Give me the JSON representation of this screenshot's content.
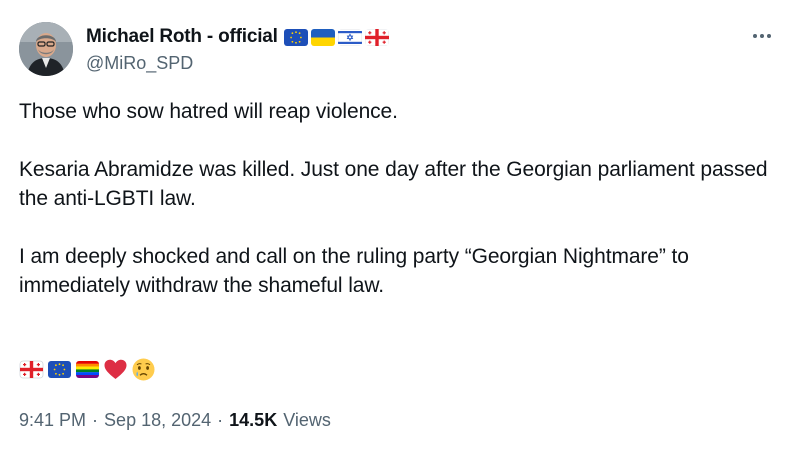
{
  "author": {
    "display_name": "Michael Roth - official",
    "handle": "@MiRo_SPD",
    "flags": [
      "eu-flag-icon",
      "ukraine-flag-icon",
      "israel-flag-icon",
      "georgia-flag-icon"
    ]
  },
  "tweet": {
    "paragraphs": [
      "Those who sow hatred will reap violence.",
      "Kesaria Abramidze  was killed. Just one day after the Georgian parliament passed the anti-LGBTI law.",
      "I am deeply shocked and call on the ruling party “Georgian Nightmare” to immediately withdraw the shameful law."
    ],
    "emojis": [
      "georgia-flag-icon",
      "eu-flag-icon",
      "rainbow-flag-icon",
      "red-heart-icon",
      "crying-face-icon"
    ]
  },
  "meta": {
    "time": "9:41 PM",
    "sep1": "·",
    "date": "Sep 18, 2024",
    "sep2": "·",
    "views_count": "14.5K",
    "views_label": "Views"
  },
  "colors": {
    "text": "#0f1419",
    "secondary": "#536471"
  }
}
